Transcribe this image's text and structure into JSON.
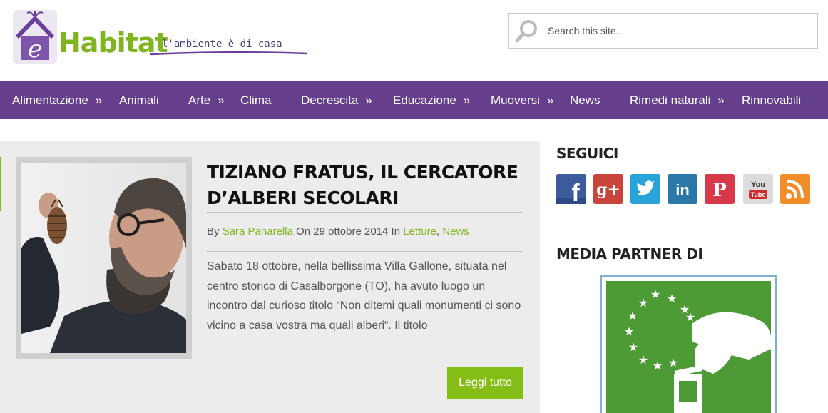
{
  "header": {
    "logo_letter": "e",
    "logo_word": "Habitat",
    "logo_tagline": "l'ambiente è di casa",
    "search_placeholder": "Search this site...",
    "search_icon": "search-icon"
  },
  "nav": {
    "items": [
      {
        "label": "Alimentazione",
        "has_submenu": true
      },
      {
        "label": "Animali",
        "has_submenu": false
      },
      {
        "label": "Arte",
        "has_submenu": true
      },
      {
        "label": "Clima",
        "has_submenu": false
      },
      {
        "label": "Decrescita",
        "has_submenu": true
      },
      {
        "label": "Educazione",
        "has_submenu": true
      },
      {
        "label": "Muoversi",
        "has_submenu": true
      },
      {
        "label": "News",
        "has_submenu": false
      },
      {
        "label": "Rimedi naturali",
        "has_submenu": true
      },
      {
        "label": "Rinnovabili",
        "has_submenu": false
      }
    ],
    "arrow": "»"
  },
  "post": {
    "title": "TIZIANO FRATUS, IL CERCATORE D’ALBERI SECOLARI",
    "meta_by": "By",
    "author": "Sara Panarella",
    "meta_on": "On 29 ottobre 2014 In",
    "category_1": "Letture",
    "separator": ",",
    "category_2": "News",
    "excerpt": "Sabato 18 ottobre, nella bellissima Villa Gallone, situata nel centro storico di Casalborgone (TO), ha avuto luogo un incontro dal curioso titolo “Non ditemi quali monumenti ci sono vicino a casa vostra ma quali alberi“. Il titolo",
    "read_more": "Leggi tutto"
  },
  "sidebar": {
    "follow_title": "SEGUICI",
    "social": [
      {
        "name": "facebook",
        "glyph": "f",
        "color": "#3b5b9a"
      },
      {
        "name": "google-plus",
        "glyph": "g+",
        "color": "#c9453b"
      },
      {
        "name": "twitter",
        "glyph": "t",
        "color": "#2aa3d9"
      },
      {
        "name": "linkedin",
        "glyph": "in",
        "color": "#2a77a8"
      },
      {
        "name": "pinterest",
        "glyph": "P",
        "color": "#d8394a"
      },
      {
        "name": "youtube",
        "glyph": "You Tube",
        "color": "#dcdcdc"
      },
      {
        "name": "rss",
        "glyph": "rss",
        "color": "#f08c2a"
      }
    ],
    "partner_title": "MEDIA PARTNER DI"
  },
  "colors": {
    "brand_purple": "#653f8c",
    "brand_green": "#7fb520",
    "button_green": "#84bd15",
    "post_bg": "#ececec"
  }
}
